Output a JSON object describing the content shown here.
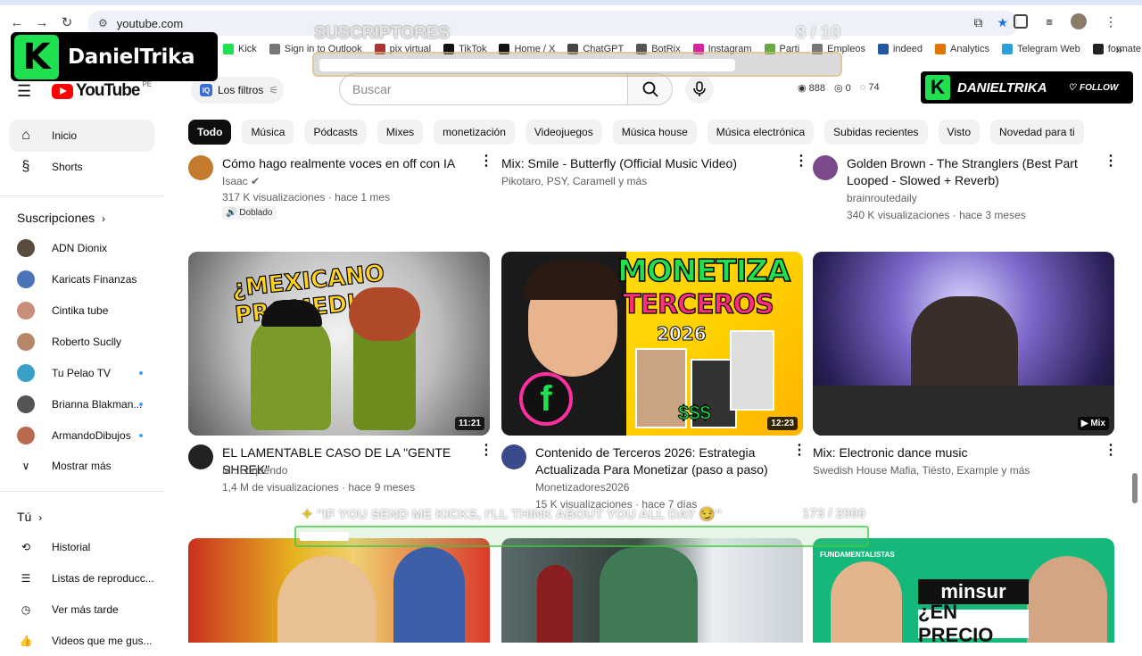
{
  "browser": {
    "url": "youtube.com",
    "bookmarks": [
      {
        "label": "Kick",
        "color": "#1fe04e"
      },
      {
        "label": "Sign in to Outlook",
        "color": "#777"
      },
      {
        "label": "pix virtual",
        "color": "#a33"
      },
      {
        "label": "TikTok",
        "color": "#111"
      },
      {
        "label": "Home / X",
        "color": "#111"
      },
      {
        "label": "ChatGPT",
        "color": "#444"
      },
      {
        "label": "BotRix",
        "color": "#555"
      },
      {
        "label": "Instagram",
        "color": "#d6249f"
      },
      {
        "label": "Parti",
        "color": "#6a4"
      },
      {
        "label": "Empleos",
        "color": "#777"
      },
      {
        "label": "indeed",
        "color": "#2557a7"
      },
      {
        "label": "Analytics",
        "color": "#e37400"
      },
      {
        "label": "Telegram Web",
        "color": "#2aa1da"
      },
      {
        "label": "formate.pe",
        "color": "#222"
      }
    ]
  },
  "overlay": {
    "brand_letter": "K",
    "brand_name": "DanielTrika",
    "subs_label": "SUSCRIPTORES",
    "subs_count": "8  / 10",
    "subs_progress": 0.8,
    "follow_name": "DANIELTRIKA",
    "follow_label": "FOLLOW",
    "kicks_message": "\"IF YOU SEND ME KICKS, I'LL THINK ABOUT YOU ALL DAY 😏\"",
    "kicks_count": "173  / 2000",
    "kicks_progress": 0.0865
  },
  "youtube": {
    "logo_text": "YouTube",
    "country": "PE",
    "filters_label": "Los filtros",
    "search_placeholder": "Buscar",
    "stats": [
      "888",
      "0",
      "74"
    ],
    "chips": [
      "Todo",
      "Música",
      "Pódcasts",
      "Mixes",
      "monetización",
      "Videojuegos",
      "Música house",
      "Música electrónica",
      "Subidas recientes",
      "Visto",
      "Novedad para ti"
    ]
  },
  "sidebar": {
    "home": "Inicio",
    "shorts": "Shorts",
    "subs_header": "Suscripciones",
    "subscriptions": [
      {
        "name": "ADN Dionix",
        "color": "#5a4b3f",
        "dot": false
      },
      {
        "name": "Karicats Finanzas",
        "color": "#4a73b9",
        "dot": false
      },
      {
        "name": "Cintika tube",
        "color": "#c98e7a",
        "dot": false
      },
      {
        "name": "Roberto Suclly",
        "color": "#b8876a",
        "dot": false
      },
      {
        "name": "Tu Pelao TV",
        "color": "#3aa0c8",
        "dot": true
      },
      {
        "name": "Brianna Blakman...",
        "color": "#555",
        "dot": true
      },
      {
        "name": "ArmandoDibujos",
        "color": "#b86a4e",
        "dot": true
      }
    ],
    "more": "Mostrar más",
    "you_header": "Tú",
    "history": "Historial",
    "playlists": "Listas de reproducc...",
    "watch_later": "Ver más tarde",
    "your_videos": "Videos que me gus..."
  },
  "videos_top": [
    {
      "title": "Cómo hago realmente voces en off con IA",
      "channel": "Isaac ✔",
      "meta": "317 K visualizaciones · hace 1 mes",
      "badge": "Doblado",
      "avatar": "#c47a2c"
    },
    {
      "title": "Mix: Smile - Butterfly (Official Music Video)",
      "channel": "Pikotaro, PSY, Caramell y más",
      "meta": "",
      "avatar": ""
    },
    {
      "title": "Golden Brown - The Stranglers (Best Part Looped - Slowed + Reverb)",
      "channel": "brainroutedaily",
      "meta": "340 K visualizaciones · hace 3 meses",
      "avatar": "#7a4a8a"
    }
  ],
  "videos_mid": [
    {
      "title": "EL LAMENTABLE CASO DE LA \"GENTE SHREK\"",
      "channel": "Mr. Loquendo",
      "meta": "1,4 M de visualizaciones · hace 9 meses",
      "duration": "11:21",
      "thumb_text": "¿MEXICANO PROMEDIO?",
      "avatar": "#222"
    },
    {
      "title": "Contenido de Terceros 2026: Estrategia Actualizada Para Monetizar (paso a paso)",
      "channel": "Monetizadores2026",
      "meta": "15 K visualizaciones · hace 7 días",
      "duration": "12:23",
      "thumb_text1": "MONETIZA",
      "thumb_text2": "TERCEROS",
      "thumb_text3": "2026",
      "thumb_text4": "$$$",
      "avatar": "#3b4a8a"
    },
    {
      "title": "Mix: Electronic dance music",
      "channel": "Swedish House Mafia, Tiësto, Example y más",
      "meta": "",
      "duration": "Mix",
      "avatar": ""
    }
  ],
  "videos_bottom": [
    {
      "thumb_text": ""
    },
    {
      "thumb_text": ""
    },
    {
      "thumb_tag": "FUNDAMENTALISTAS",
      "thumb_text1": "minsur",
      "thumb_text2": "¿EN PRECIO"
    }
  ]
}
